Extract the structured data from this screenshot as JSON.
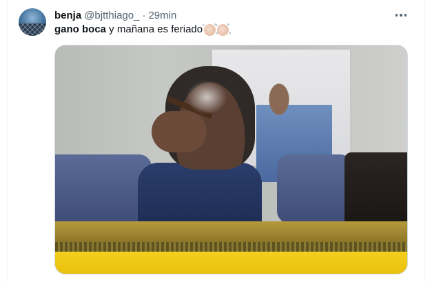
{
  "tweet": {
    "display_name": "benja",
    "handle": "@bjtthiago_",
    "separator": "·",
    "time": "29min",
    "text_bold": "gano boca",
    "text_rest": " y mañana es feriado",
    "emojis": [
      "clapping-hands-icon",
      "clapping-hands-icon"
    ],
    "more_icon": "more-horizontal-icon"
  },
  "colors": {
    "text": "#0f1419",
    "secondary": "#536471",
    "border": "#cfd9de",
    "banner_yellow": "#f3cf1f",
    "seat_blue": "#4a5785"
  }
}
